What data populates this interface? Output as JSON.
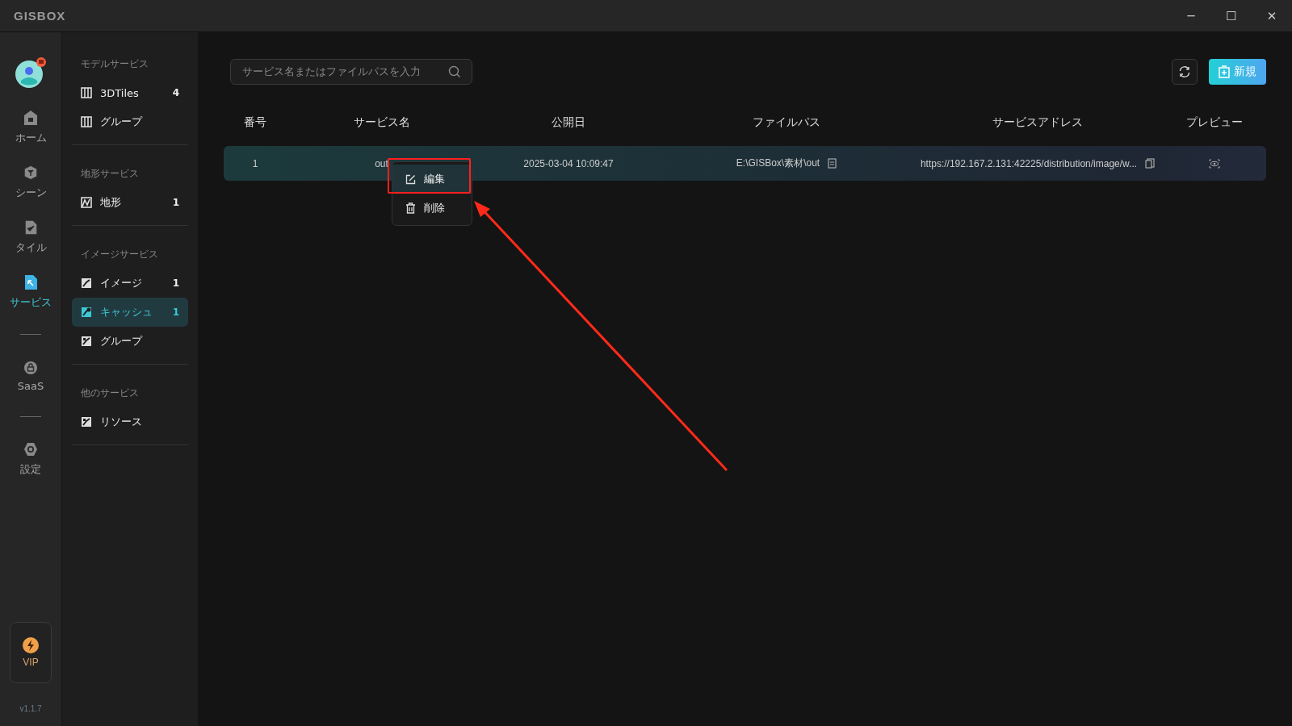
{
  "window": {
    "title": "GISBOX",
    "controls": [
      "─",
      "☐",
      "✕"
    ]
  },
  "rail": {
    "items": [
      {
        "label": "ホーム",
        "kind": "home",
        "selected": false
      },
      {
        "label": "シーン",
        "kind": "scene",
        "selected": false
      },
      {
        "label": "タイル",
        "kind": "tile",
        "selected": false
      },
      {
        "label": "サービス",
        "kind": "service",
        "selected": true
      },
      {
        "label": "SaaS",
        "kind": "saas",
        "selected": false
      },
      {
        "label": "設定",
        "kind": "settings",
        "selected": false
      }
    ],
    "vip": "VIP",
    "version": "v1.1.7"
  },
  "sidebar": {
    "sections": [
      {
        "title": "モデルサービス",
        "items": [
          {
            "label": "3DTiles",
            "count": "4",
            "kind": "model",
            "selected": false
          },
          {
            "label": "グループ",
            "kind": "model",
            "selected": false
          }
        ]
      },
      {
        "title": "地形サービス",
        "items": [
          {
            "label": "地形",
            "count": "1",
            "kind": "terrain",
            "selected": false
          }
        ]
      },
      {
        "title": "イメージサービス",
        "items": [
          {
            "label": "イメージ",
            "count": "1",
            "kind": "image",
            "selected": false
          },
          {
            "label": "キャッシュ",
            "count": "1",
            "kind": "cache",
            "selected": true
          },
          {
            "label": "グループ",
            "kind": "group",
            "selected": false
          }
        ]
      },
      {
        "title": "他のサービス",
        "items": [
          {
            "label": "リソース",
            "kind": "resource",
            "selected": false
          }
        ]
      }
    ]
  },
  "search": {
    "placeholder": "サービス名またはファイルパスを入力"
  },
  "new_button": "新規",
  "table": {
    "columns": [
      "番号",
      "サービス名",
      "公開日",
      "ファイルパス",
      "サービスアドレス",
      "プレビュー"
    ],
    "rows": [
      {
        "number": "1",
        "name": "out",
        "date": "2025-03-04 10:09:47",
        "path": "E:\\GISBox\\素材\\out",
        "address": "https://192.167.2.131:42225/distribution/image/w..."
      }
    ]
  },
  "context_menu": [
    {
      "label": "編集",
      "kind": "edit",
      "selected": true
    },
    {
      "label": "削除",
      "kind": "delete",
      "selected": false
    }
  ]
}
